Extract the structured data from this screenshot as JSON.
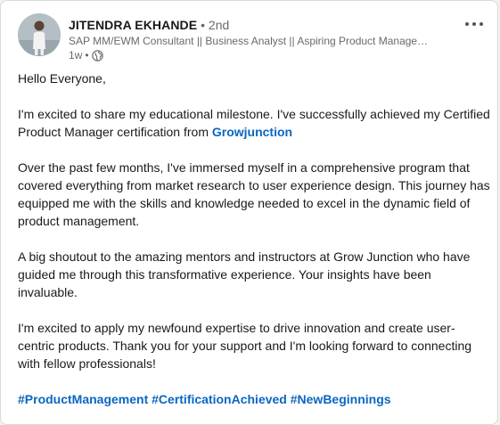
{
  "author": {
    "name": "JITENDRA EKHANDE",
    "degree_separator": " • ",
    "degree": "2nd",
    "headline": "SAP MM/EWM Consultant || Business Analyst || Aspiring Product Manageme...",
    "time": "1w",
    "meta_separator": " • ",
    "visibility_icon": "globe-icon"
  },
  "menu": {
    "icon": "more-horizontal-icon"
  },
  "post": {
    "greeting": "Hello Everyone,",
    "p1_text": "I'm excited to share my educational milestone. I've successfully achieved my Certified Product Manager certification from ",
    "p1_link": "Growjunction",
    "p2": "Over the past few months, I've immersed myself in a comprehensive program that covered everything from market research to user experience design. This journey has equipped me with the skills and knowledge needed to excel in the dynamic field of product management.",
    "p3": "A big shoutout to the amazing mentors and instructors at Grow Junction who have guided me through this transformative experience. Your insights have been invaluable.",
    "p4": "I'm excited to apply my newfound expertise to drive innovation and create user-centric products. Thank you for your support and I'm looking forward to connecting with fellow professionals!",
    "hashtags": [
      "#ProductManagement",
      "#CertificationAchieved",
      "#NewBeginnings"
    ]
  },
  "colors": {
    "link": "#0a66c2",
    "card_bg": "#ffffff",
    "secondary_text": "#666666"
  }
}
